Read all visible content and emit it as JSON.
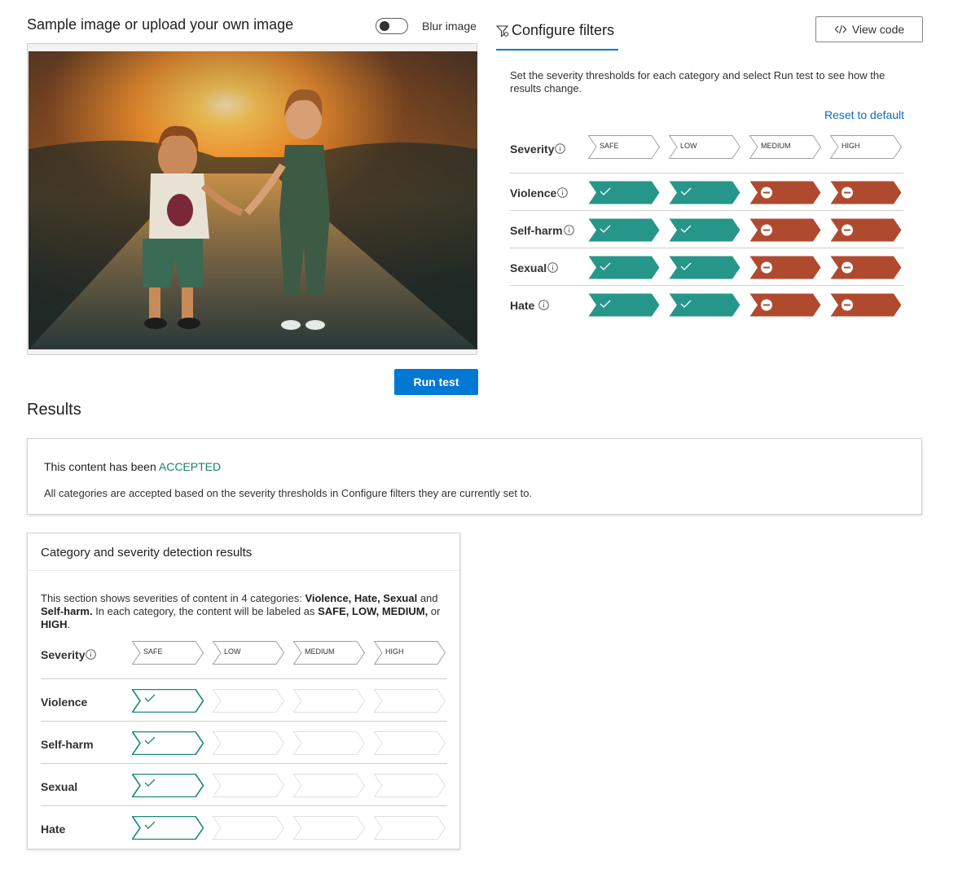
{
  "left": {
    "sample_title": "Sample image or upload your own image",
    "blur_label": "Blur image",
    "blur_enabled": false,
    "run_test_label": "Run test"
  },
  "configure": {
    "title": "Configure filters",
    "view_code_label": "View code",
    "description": "Set the severity thresholds for each category and select Run test to see how the results change.",
    "reset_label": "Reset to default",
    "severity_label": "Severity",
    "severity_levels": [
      "SAFE",
      "LOW",
      "MEDIUM",
      "HIGH"
    ],
    "categories": [
      {
        "name": "Violence",
        "levels": [
          "allow",
          "allow",
          "block",
          "block"
        ]
      },
      {
        "name": "Self-harm",
        "levels": [
          "allow",
          "allow",
          "block",
          "block"
        ]
      },
      {
        "name": "Sexual",
        "levels": [
          "allow",
          "allow",
          "block",
          "block"
        ]
      },
      {
        "name": "Hate",
        "levels": [
          "allow",
          "allow",
          "block",
          "block"
        ]
      }
    ]
  },
  "results": {
    "title": "Results",
    "accepted_prefix": "This content has been ",
    "accepted_status": "ACCEPTED",
    "accepted_description": "All categories are accepted based on the severity thresholds in Configure filters they are currently set to."
  },
  "detection": {
    "title": "Category and severity detection results",
    "desc_part1": "This section shows severities of content in 4 categories: ",
    "desc_categories": "Violence, Hate, Sexual",
    "desc_and": " and ",
    "desc_selfharm": "Self-harm.",
    "desc_part2": " In each category, the content will be labeled as ",
    "desc_levels": "SAFE, LOW, MEDIUM,",
    "desc_or": " or ",
    "desc_high": "HIGH",
    "desc_end": ".",
    "severity_label": "Severity",
    "severity_levels": [
      "SAFE",
      "LOW",
      "MEDIUM",
      "HIGH"
    ],
    "categories": [
      {
        "name": "Violence",
        "detected": "SAFE"
      },
      {
        "name": "Self-harm",
        "detected": "SAFE"
      },
      {
        "name": "Sexual",
        "detected": "SAFE"
      },
      {
        "name": "Hate",
        "detected": "SAFE"
      }
    ]
  },
  "colors": {
    "accent": "#0078d4",
    "allow": "#26968a",
    "block": "#b04a2f",
    "accepted": "#1a7f6e",
    "chevron_border": "#a19f9d",
    "detected_border": "#1a8a7a",
    "empty_border": "#e1dfdd"
  },
  "icons": {
    "filter": "filter-icon",
    "code": "code-icon",
    "info": "info-icon",
    "check": "check-icon",
    "minus": "minus-circle-icon"
  }
}
